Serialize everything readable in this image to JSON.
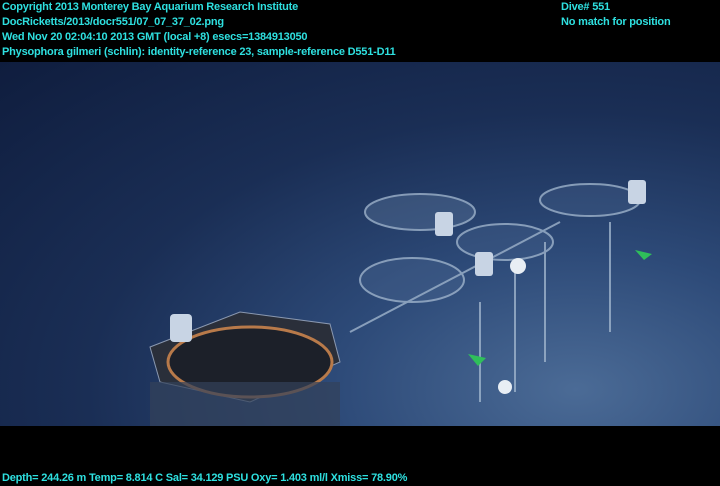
{
  "header": {
    "lines": [
      "Copyright 2013 Monterey Bay Aquarium Research Institute",
      "DocRicketts/2013/docr551/07_07_37_02.png",
      "Wed Nov 20 02:04:10 2013 GMT (local +8)  esecs=1384913050",
      "Physophora gilmeri (schlin): identity-reference 23, sample-reference D551-D11"
    ],
    "dive": "Dive# 551",
    "position": "No match for position"
  },
  "footer": {
    "sensors": "Depth= 244.26 m  Temp= 8.814 C  Sal= 34.129 PSU  Oxy= 1.403 ml/l  Xmiss= 78.90%"
  },
  "colors": {
    "overlay_text": "#2ee0e0",
    "water": "#1a2e55"
  }
}
